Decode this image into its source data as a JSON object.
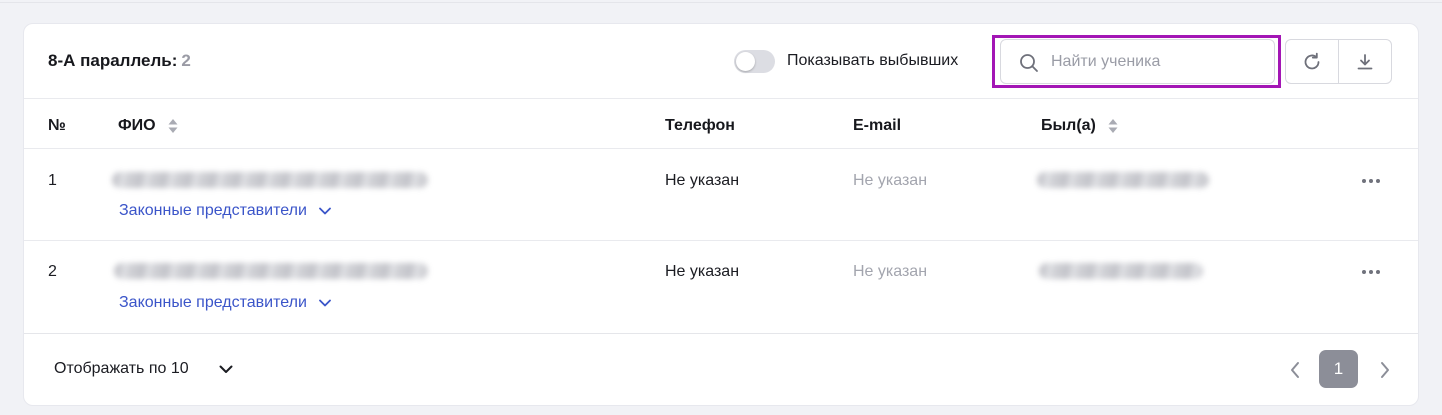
{
  "header": {
    "title": "8-А параллель:",
    "count": "2",
    "toggle_label": "Показывать выбывших",
    "toggle_on": false
  },
  "search": {
    "value": "",
    "placeholder": "Найти ученика"
  },
  "icons": {
    "search": "search-icon",
    "refresh": "refresh-icon",
    "download": "download-icon",
    "sort": "sort-icon",
    "expand": "chevron-down-icon",
    "more": "more-dots-icon",
    "prev": "chevron-left-icon",
    "next": "chevron-right-icon"
  },
  "table": {
    "columns": {
      "no": "№",
      "fio": "ФИО",
      "phone": "Телефон",
      "email": "E-mail",
      "was": "Был(а)"
    },
    "rows": [
      {
        "no": "1",
        "phone": "Не указан",
        "email": "Не указан",
        "representatives": "Законные представители"
      },
      {
        "no": "2",
        "phone": "Не указан",
        "email": "Не указан",
        "representatives": "Законные представители"
      }
    ]
  },
  "footer": {
    "per_page_label": "Отображать по 10",
    "current_page": "1"
  },
  "colors": {
    "accent_link": "#3b55c9",
    "highlight": "#a316b5",
    "page_active": "#8c8e98"
  }
}
